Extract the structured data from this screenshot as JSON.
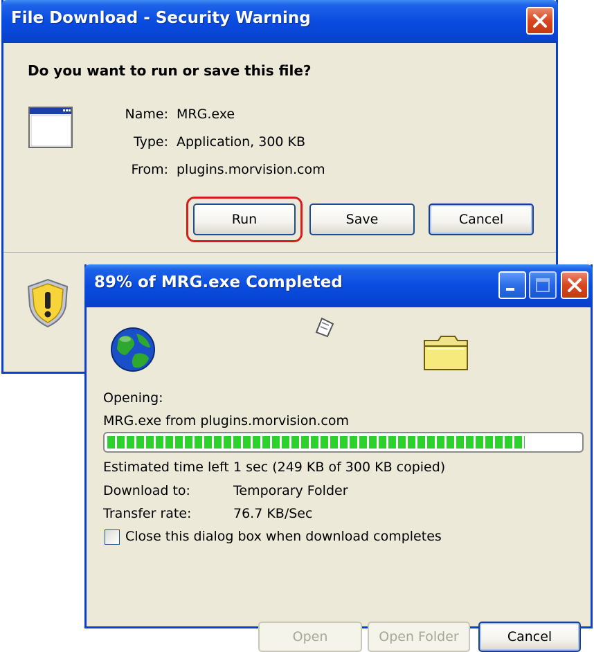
{
  "security_dialog": {
    "title": "File Download - Security Warning",
    "question": "Do you want to run or save this file?",
    "name_label": "Name:",
    "name_value": "MRG.exe",
    "type_label": "Type:",
    "type_value": "Application, 300 KB",
    "from_label": "From:",
    "from_value": "plugins.morvision.com",
    "run_label": "Run",
    "save_label": "Save",
    "cancel_label": "Cancel",
    "highlight_color": "#d81c1c"
  },
  "progress_dialog": {
    "title": "89% of MRG.exe Completed",
    "opening_label": "Opening:",
    "opening_value": "MRG.exe from plugins.morvision.com",
    "progress_fraction": 0.89,
    "estimated_label": "Estimated time left",
    "estimated_value": "1 sec (249 KB of 300 KB copied)",
    "download_to_label": "Download to:",
    "download_to_value": "Temporary Folder",
    "transfer_rate_label": "Transfer rate:",
    "transfer_rate_value": "76.7 KB/Sec",
    "close_checkbox_label": "Close this dialog box when download completes",
    "close_checkbox_checked": false,
    "open_label": "Open",
    "open_folder_label": "Open Folder",
    "cancel_label": "Cancel",
    "progress_color": "#2cd12c"
  },
  "icons": [
    "window-app-icon",
    "shield-warning-icon",
    "globe-icon",
    "paper-fly-icon",
    "folder-icon",
    "close-icon",
    "minimize-icon",
    "maximize-icon"
  ]
}
